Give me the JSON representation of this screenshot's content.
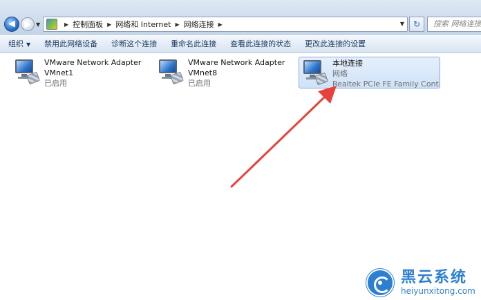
{
  "address_bar": {
    "breadcrumbs": [
      "控制面板",
      "网络和 Internet",
      "网络连接"
    ],
    "search_placeholder": "搜索 网络连接"
  },
  "toolbar": {
    "items": [
      "组织",
      "禁用此网络设备",
      "诊断这个连接",
      "重命名此连接",
      "查看此连接的状态",
      "更改此连接的设置"
    ]
  },
  "connections": [
    {
      "name": "VMware Network Adapter",
      "line2": "VMnet1",
      "status": "已启用",
      "selected": false
    },
    {
      "name": "VMware Network Adapter",
      "line2": "VMnet8",
      "status": "已启用",
      "selected": false
    },
    {
      "name": "本地连接",
      "line2": "网络",
      "status": "Realtek PCIe FE Family Control...",
      "selected": true
    }
  ],
  "watermark": {
    "chinese": "黑云系统",
    "site": "heiyunxitong.com"
  },
  "colors": {
    "arrow": "#e8413b",
    "selection": "#cfe2f8",
    "brand": "#2d7fd3"
  }
}
